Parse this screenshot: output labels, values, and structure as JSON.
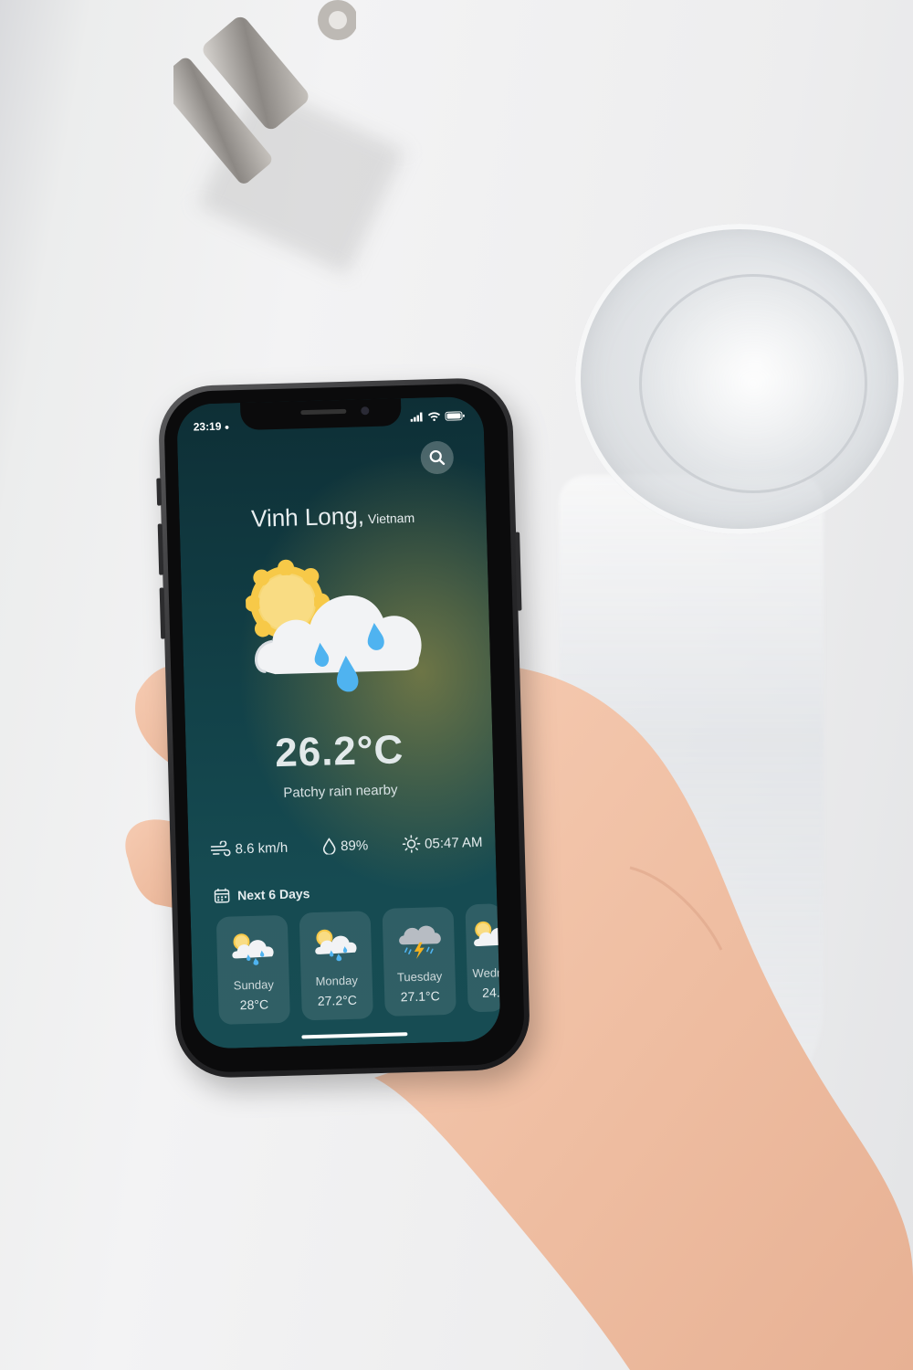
{
  "status_bar": {
    "time": "23:19"
  },
  "location": {
    "city": "Vinh Long,",
    "country": "Vietnam"
  },
  "current": {
    "temperature": "26.2°C",
    "condition": "Patchy rain nearby",
    "icon": "sun-cloud-rain-icon"
  },
  "stats": {
    "wind": {
      "value": "8.6 km/h",
      "icon": "wind-icon"
    },
    "humidity": {
      "value": "89%",
      "icon": "droplet-icon"
    },
    "sunrise": {
      "value": "05:47 AM",
      "icon": "sun-icon"
    }
  },
  "forecast": {
    "title": "Next 6 Days",
    "days": [
      {
        "name": "Sunday",
        "temp": "28°C",
        "icon": "sun-cloud-rain-icon"
      },
      {
        "name": "Monday",
        "temp": "27.2°C",
        "icon": "sun-cloud-rain-icon"
      },
      {
        "name": "Tuesday",
        "temp": "27.1°C",
        "icon": "thunder-rain-icon"
      },
      {
        "name": "Wedr",
        "temp": "24.",
        "icon": "sun-cloud-rain-icon"
      }
    ]
  },
  "colors": {
    "sun": "#f7d774",
    "cloud": "#f2f3f5",
    "rain": "#4fb3f0",
    "bolt": "#f5b21f"
  }
}
